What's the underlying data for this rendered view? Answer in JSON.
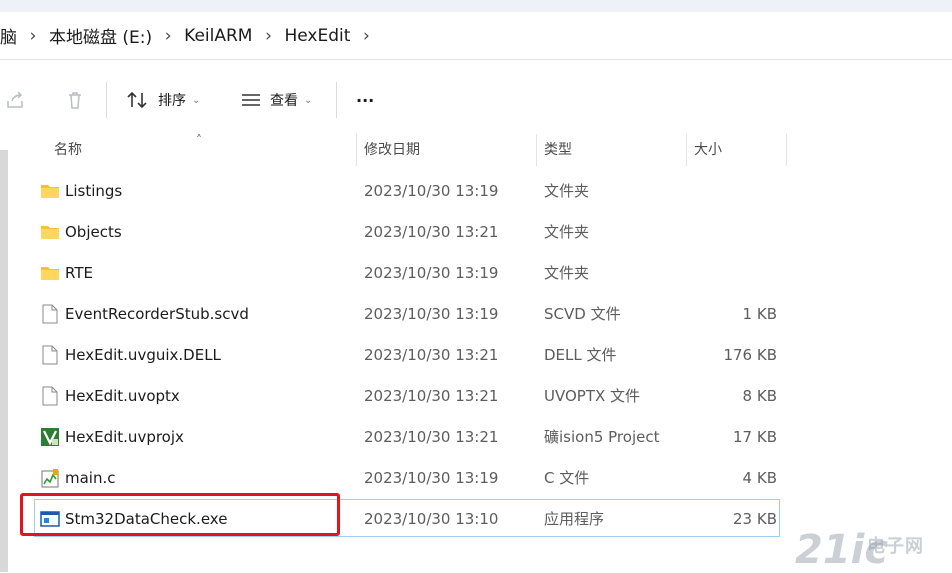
{
  "breadcrumb": [
    "脑",
    "本地磁盘 (E:)",
    "KeilARM",
    "HexEdit"
  ],
  "toolbar": {
    "sort_label": "排序",
    "view_label": "查看",
    "more_label": "···"
  },
  "columns": {
    "name": "名称",
    "date": "修改日期",
    "type": "类型",
    "size": "大小"
  },
  "files": [
    {
      "name": "Listings",
      "date": "2023/10/30 13:19",
      "type": "文件夹",
      "size": "",
      "icon": "folder-icon"
    },
    {
      "name": "Objects",
      "date": "2023/10/30 13:21",
      "type": "文件夹",
      "size": "",
      "icon": "folder-icon"
    },
    {
      "name": "RTE",
      "date": "2023/10/30 13:19",
      "type": "文件夹",
      "size": "",
      "icon": "folder-icon"
    },
    {
      "name": "EventRecorderStub.scvd",
      "date": "2023/10/30 13:19",
      "type": "SCVD 文件",
      "size": "1 KB",
      "icon": "file-icon"
    },
    {
      "name": "HexEdit.uvguix.DELL",
      "date": "2023/10/30 13:21",
      "type": "DELL 文件",
      "size": "176 KB",
      "icon": "file-icon"
    },
    {
      "name": "HexEdit.uvoptx",
      "date": "2023/10/30 13:21",
      "type": "UVOPTX 文件",
      "size": "8 KB",
      "icon": "file-icon"
    },
    {
      "name": "HexEdit.uvprojx",
      "date": "2023/10/30 13:21",
      "type": "礦ision5 Project",
      "size": "17 KB",
      "icon": "keil-project-icon"
    },
    {
      "name": "main.c",
      "date": "2023/10/30 13:19",
      "type": "C 文件",
      "size": "4 KB",
      "icon": "c-source-icon"
    },
    {
      "name": "Stm32DataCheck.exe",
      "date": "2023/10/30 13:10",
      "type": "应用程序",
      "size": "23 KB",
      "icon": "exe-icon"
    }
  ],
  "watermark": {
    "big": "21ic",
    "small": "电子网"
  },
  "colors": {
    "highlight_box": "#e3141c",
    "selection_border": "#9fcef0",
    "folder": "#f4c430"
  }
}
